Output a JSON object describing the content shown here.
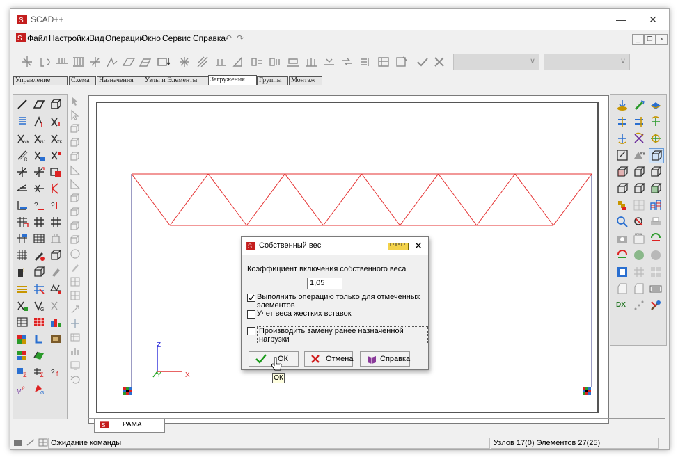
{
  "window": {
    "title": "SCAD++"
  },
  "menu": {
    "items": [
      "Файл",
      "Настройки",
      "Вид",
      "Операции",
      "Окно",
      "Сервис",
      "Справка"
    ]
  },
  "tabs": [
    "Управление",
    "Схема",
    "Назначения",
    "Узлы и Элементы",
    "Загружения",
    "Группы",
    "Монтаж"
  ],
  "active_tab": "Загружения",
  "canvas": {
    "axes": {
      "z": "Z",
      "y": "Y",
      "x": "X"
    },
    "doc_tab": "РАМА",
    "colors": {
      "truss": "#e53030",
      "columns": "#3a3a8a",
      "axes": "#2b2bd9",
      "x_axis": "#e03030",
      "y_axis": "#1aa01a"
    }
  },
  "dialog": {
    "title": "Собственный вес",
    "coef_label": "Коэффициент включения собственного веса",
    "coef_value": "1,05",
    "checkboxes": [
      {
        "label": "Выполнить операцию только для отмеченных элементов",
        "checked": true
      },
      {
        "label": "Учет веса жестких вставок",
        "checked": false
      },
      {
        "label": "Производить замену ранее назначенной нагрузки",
        "checked": false
      }
    ],
    "buttons": {
      "ok": "ОК",
      "cancel": "Отмена",
      "help": "Справка"
    }
  },
  "tooltip": "ОК",
  "status": {
    "message": "Ожидание команды",
    "info": "Узлов 17(0) Элементов 27(25)"
  }
}
